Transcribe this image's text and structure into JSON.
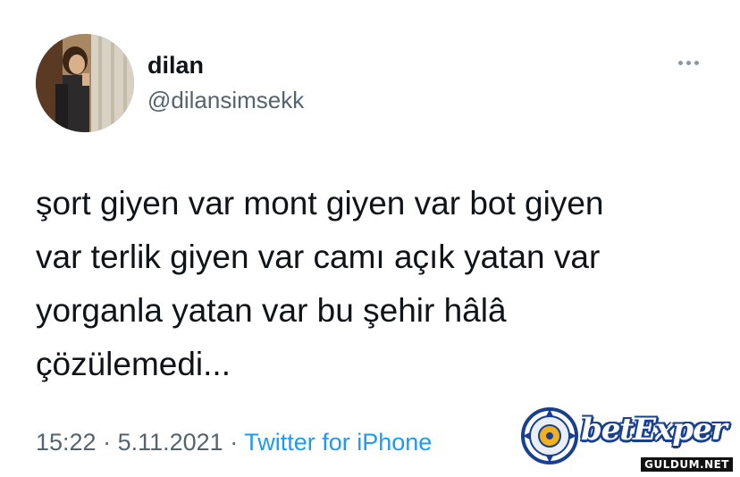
{
  "tweet": {
    "display_name": "dilan",
    "handle": "@dilansimsekk",
    "text": "şort giyen var mont giyen var bot giyen\nvar terlik giyen var camı açık yatan var\nyorganla yatan var bu şehir hâlâ\nçözülemedi...",
    "time": "15:22",
    "separator": " · ",
    "date": "5.11.2021",
    "source": "Twitter for iPhone"
  },
  "icons": {
    "avatar": "profile-photo",
    "more": "more-horizontal-icon"
  },
  "watermark": {
    "brand": "betExper",
    "site": "GULDUM.NET"
  },
  "colors": {
    "text": "#0f1419",
    "secondary": "#536471",
    "link": "#1d9bf0",
    "brand_blue": "#18408f"
  }
}
